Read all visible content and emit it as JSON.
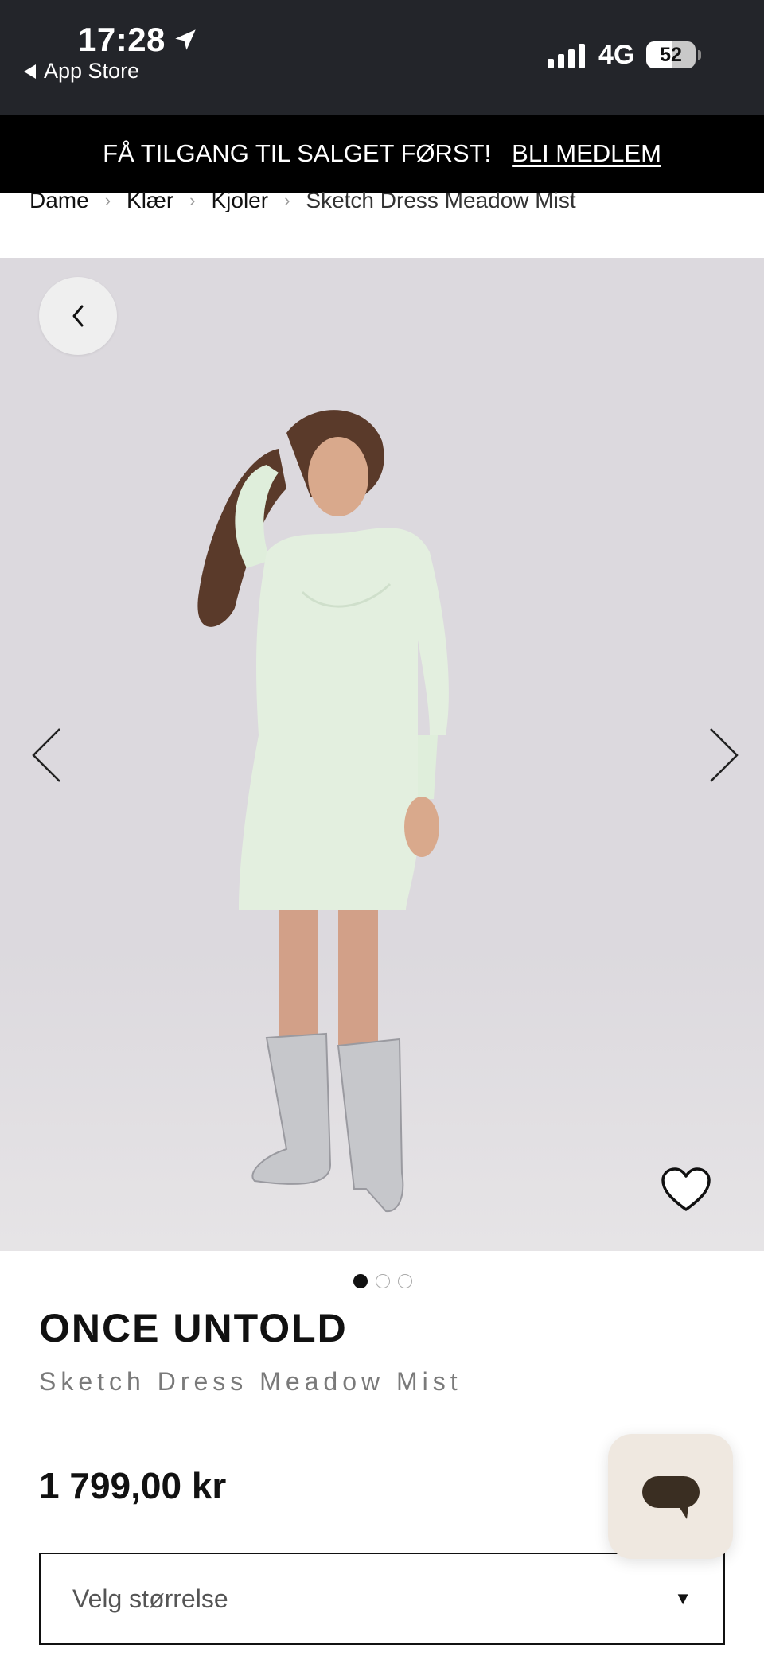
{
  "status_bar": {
    "time": "17:28",
    "back_app": "App Store",
    "network": "4G",
    "battery": "52",
    "battery_level": 0.52
  },
  "promo": {
    "text": "FÅ TILGANG TIL SALGET FØRST!",
    "link": "BLI MEDLEM"
  },
  "breadcrumb": {
    "items": [
      "Dame",
      "Klær",
      "Kjoler"
    ],
    "current": "Sketch Dress Meadow Mist"
  },
  "gallery": {
    "image_count": 3,
    "active_index": 0,
    "icons": [
      "chevron-left-icon",
      "arrow-left-icon",
      "arrow-right-icon",
      "heart-icon"
    ]
  },
  "product": {
    "brand": "ONCE UNTOLD",
    "name": "Sketch Dress Meadow Mist",
    "price": "1 799,00 kr"
  },
  "size_select": {
    "placeholder": "Velg størrelse"
  },
  "colors": {
    "banner_bg": "#000000",
    "status_bg": "#23252a",
    "image_bg": "#dcd9de",
    "chat_bg": "#efe8e0",
    "chat_icon": "#3a2e22"
  }
}
